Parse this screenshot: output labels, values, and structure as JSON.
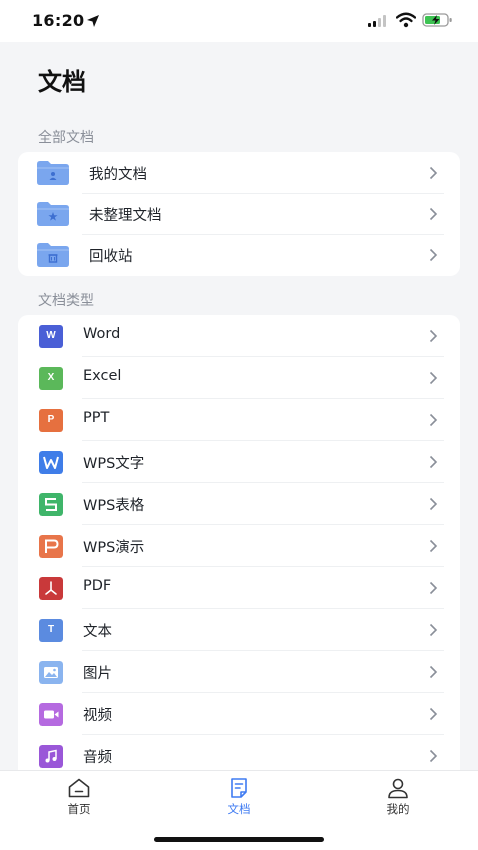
{
  "status_bar": {
    "time": "16:20"
  },
  "page": {
    "title": "文档"
  },
  "all_docs": {
    "section_label": "全部文档",
    "items": [
      {
        "label": "我的文档",
        "icon": "folder-user-icon"
      },
      {
        "label": "未整理文档",
        "icon": "folder-star-icon"
      },
      {
        "label": "回收站",
        "icon": "folder-trash-icon"
      }
    ]
  },
  "doc_types": {
    "section_label": "文档类型",
    "items": [
      {
        "label": "Word",
        "icon": "word-icon",
        "color": "#4a5fd6"
      },
      {
        "label": "Excel",
        "icon": "excel-icon",
        "color": "#5bb85a"
      },
      {
        "label": "PPT",
        "icon": "ppt-icon",
        "color": "#e6703f"
      },
      {
        "label": "WPS文字",
        "icon": "wps-writer-icon",
        "color": "#3f7de8"
      },
      {
        "label": "WPS表格",
        "icon": "wps-sheet-icon",
        "color": "#3fb56a"
      },
      {
        "label": "WPS演示",
        "icon": "wps-slides-icon",
        "color": "#e8754a"
      },
      {
        "label": "PDF",
        "icon": "pdf-icon",
        "color": "#c9393a"
      },
      {
        "label": "文本",
        "icon": "text-icon",
        "color": "#5b8be0"
      },
      {
        "label": "图片",
        "icon": "image-icon",
        "color": "#8ab4ef"
      },
      {
        "label": "视频",
        "icon": "video-icon",
        "color": "#b56ae0"
      },
      {
        "label": "音频",
        "icon": "audio-icon",
        "color": "#9a57d8"
      }
    ]
  },
  "tab_bar": {
    "tabs": [
      {
        "label": "首页",
        "icon": "home-icon",
        "active": false
      },
      {
        "label": "文档",
        "icon": "document-icon",
        "active": true
      },
      {
        "label": "我的",
        "icon": "user-icon",
        "active": false
      }
    ]
  },
  "colors": {
    "accent": "#3f7bf2",
    "folder": "#7aa6ee",
    "background": "#f4f5f7"
  }
}
